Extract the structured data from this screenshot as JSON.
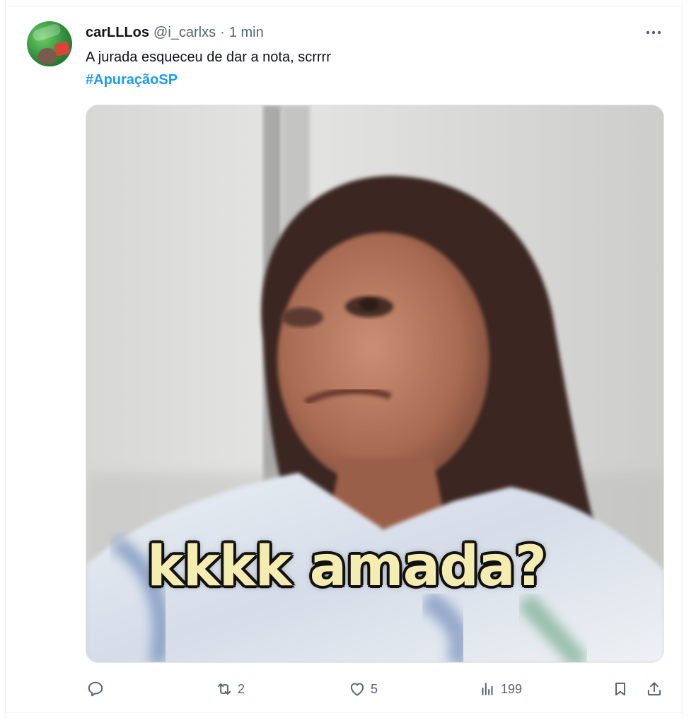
{
  "tweet": {
    "display_name": "carLLLos",
    "handle": "@i_carlxs",
    "separator": "·",
    "time": "1 min",
    "text": "A jurada esqueceu de dar a nota, scrrrr",
    "hashtag": "#ApuraçãoSP"
  },
  "media": {
    "caption": "kkkk amada?"
  },
  "actions": {
    "reply": {
      "icon": "reply-icon",
      "count": ""
    },
    "retweet": {
      "icon": "retweet-icon",
      "count": "2"
    },
    "like": {
      "icon": "heart-icon",
      "count": "5"
    },
    "views": {
      "icon": "views-chart-icon",
      "count": "199"
    },
    "bookmark": {
      "icon": "bookmark-icon"
    },
    "share": {
      "icon": "share-icon"
    }
  },
  "colors": {
    "text": "#0f1419",
    "muted": "#536471",
    "link": "#1d9bf0",
    "border": "#eff3f4"
  }
}
